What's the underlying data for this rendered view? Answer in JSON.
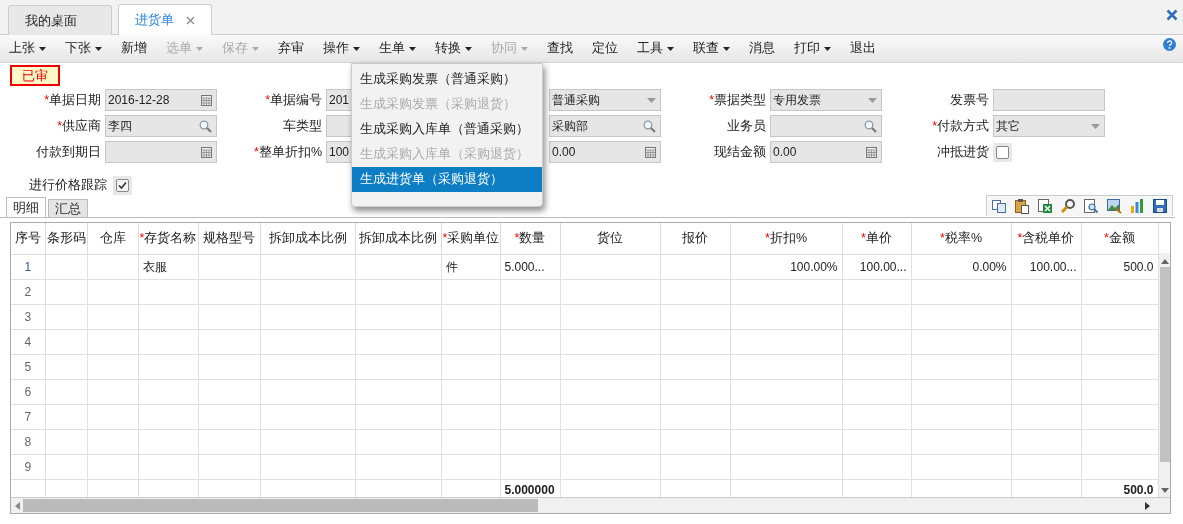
{
  "tabs": [
    {
      "label": "我的桌面",
      "selected": false,
      "closable": false
    },
    {
      "label": "进货单",
      "selected": true,
      "closable": true
    }
  ],
  "toolbar": [
    {
      "label": "上张",
      "dropdown": true,
      "disabled": false
    },
    {
      "label": "下张",
      "dropdown": true,
      "disabled": false
    },
    {
      "label": "新增",
      "dropdown": false,
      "disabled": false
    },
    {
      "label": "选单",
      "dropdown": true,
      "disabled": true
    },
    {
      "label": "保存",
      "dropdown": true,
      "disabled": true
    },
    {
      "label": "弃审",
      "dropdown": false,
      "disabled": false
    },
    {
      "label": "操作",
      "dropdown": true,
      "disabled": false
    },
    {
      "label": "生单",
      "dropdown": true,
      "disabled": false
    },
    {
      "label": "转换",
      "dropdown": true,
      "disabled": false
    },
    {
      "label": "协同",
      "dropdown": true,
      "disabled": true
    },
    {
      "label": "查找",
      "dropdown": false,
      "disabled": false
    },
    {
      "label": "定位",
      "dropdown": false,
      "disabled": false
    },
    {
      "label": "工具",
      "dropdown": true,
      "disabled": false
    },
    {
      "label": "联查",
      "dropdown": true,
      "disabled": false
    },
    {
      "label": "消息",
      "dropdown": false,
      "disabled": false
    },
    {
      "label": "打印",
      "dropdown": true,
      "disabled": false
    },
    {
      "label": "退出",
      "dropdown": false,
      "disabled": false
    }
  ],
  "status_badge": "已审",
  "form": {
    "rows": [
      [
        {
          "marker": "*",
          "label": "单据日期",
          "kind": "date",
          "value": "2016-12-28"
        },
        {
          "marker": "*",
          "label": "单据编号",
          "kind": "text",
          "value": "201"
        },
        {
          "kind": "select",
          "value": "普通采购"
        },
        {
          "marker": "*",
          "label": "票据类型",
          "kind": "select",
          "value": "专用发票"
        },
        {
          "label": "发票号",
          "kind": "text"
        }
      ],
      [
        {
          "marker": "*",
          "label": "供应商",
          "kind": "lookup",
          "value": "李四"
        },
        {
          "label": "车类型",
          "kind": "text"
        },
        {
          "kind": "lookup",
          "value": "采购部"
        },
        {
          "label": "业务员",
          "kind": "lookup"
        },
        {
          "marker": "*",
          "label": "付款方式",
          "kind": "select",
          "value": "其它"
        }
      ],
      [
        {
          "label": "付款到期日",
          "kind": "date"
        },
        {
          "marker": "*",
          "label": "整单折扣%",
          "kind": "text",
          "value": "100"
        },
        {
          "kind": "number",
          "value": "0.00"
        },
        {
          "label": "现结金额",
          "kind": "number",
          "value": "0.00"
        },
        {
          "label": "冲抵进货",
          "kind": "checkbox",
          "checked": false
        }
      ]
    ],
    "price_tracking": {
      "label": "进行价格跟踪",
      "checked": true
    }
  },
  "menu": [
    {
      "label": "生成采购发票（普通采购）",
      "disabled": false,
      "selected": false
    },
    {
      "label": "生成采购发票（采购退货）",
      "disabled": true,
      "selected": false
    },
    {
      "label": "生成采购入库单（普通采购）",
      "disabled": false,
      "selected": false
    },
    {
      "label": "生成采购入库单（采购退货）",
      "disabled": true,
      "selected": false
    },
    {
      "label": "生成进货单（采购退货）",
      "disabled": false,
      "selected": true
    }
  ],
  "subtabs": [
    {
      "label": "明细",
      "selected": true
    },
    {
      "label": "汇总",
      "selected": false
    }
  ],
  "table": {
    "columns": [
      {
        "label": "序号"
      },
      {
        "label": "条形码"
      },
      {
        "label": "仓库"
      },
      {
        "marker": "*",
        "label": "存货名称"
      },
      {
        "label": "规格型号"
      },
      {
        "label": "拆卸成本比例"
      },
      {
        "label": "拆卸成本比例"
      },
      {
        "marker": "*",
        "label": "采购单位"
      },
      {
        "marker": "*",
        "label": "数量"
      },
      {
        "label": "货位"
      },
      {
        "label": "报价"
      },
      {
        "marker": "*",
        "label": "折扣%"
      },
      {
        "marker": "*",
        "label": "单价"
      },
      {
        "marker": "*",
        "label": "税率%"
      },
      {
        "marker": "*",
        "label": "含税单价"
      },
      {
        "marker": "*",
        "label": "金额"
      }
    ],
    "rows": [
      {
        "seq": "1",
        "item_name": "衣服",
        "unit": "件",
        "quantity": "5.000...",
        "discount": "100.00%",
        "price": "100.00...",
        "tax_rate": "0.00%",
        "price_with_tax": "100.00...",
        "amount": "500.0"
      },
      {
        "seq": "2"
      },
      {
        "seq": "3"
      },
      {
        "seq": "4"
      },
      {
        "seq": "5"
      },
      {
        "seq": "6"
      },
      {
        "seq": "7"
      },
      {
        "seq": "8"
      },
      {
        "seq": "9"
      }
    ],
    "totals": {
      "quantity": "5.000000",
      "amount": "500.0"
    }
  }
}
